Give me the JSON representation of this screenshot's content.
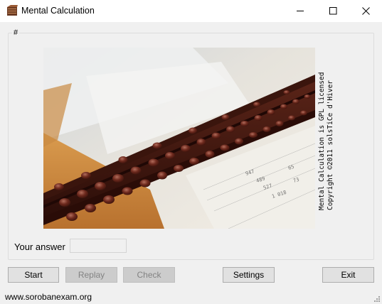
{
  "window": {
    "title": "Mental Calculation",
    "icon": "abacus-icon",
    "controls": [
      "minimize-icon",
      "maximize-icon",
      "close-icon"
    ]
  },
  "group": {
    "label": "#"
  },
  "credits": {
    "line1": "Mental Calculation is GPL licensed",
    "line2": "Copyright ©2011 solsTiCe d'Hiver"
  },
  "answer": {
    "label": "Your answer",
    "value": ""
  },
  "buttons": {
    "start": "Start",
    "replay": "Replay",
    "check": "Check",
    "settings": "Settings",
    "exit": "Exit"
  },
  "status": {
    "url": "www.sorobanexam.org"
  }
}
